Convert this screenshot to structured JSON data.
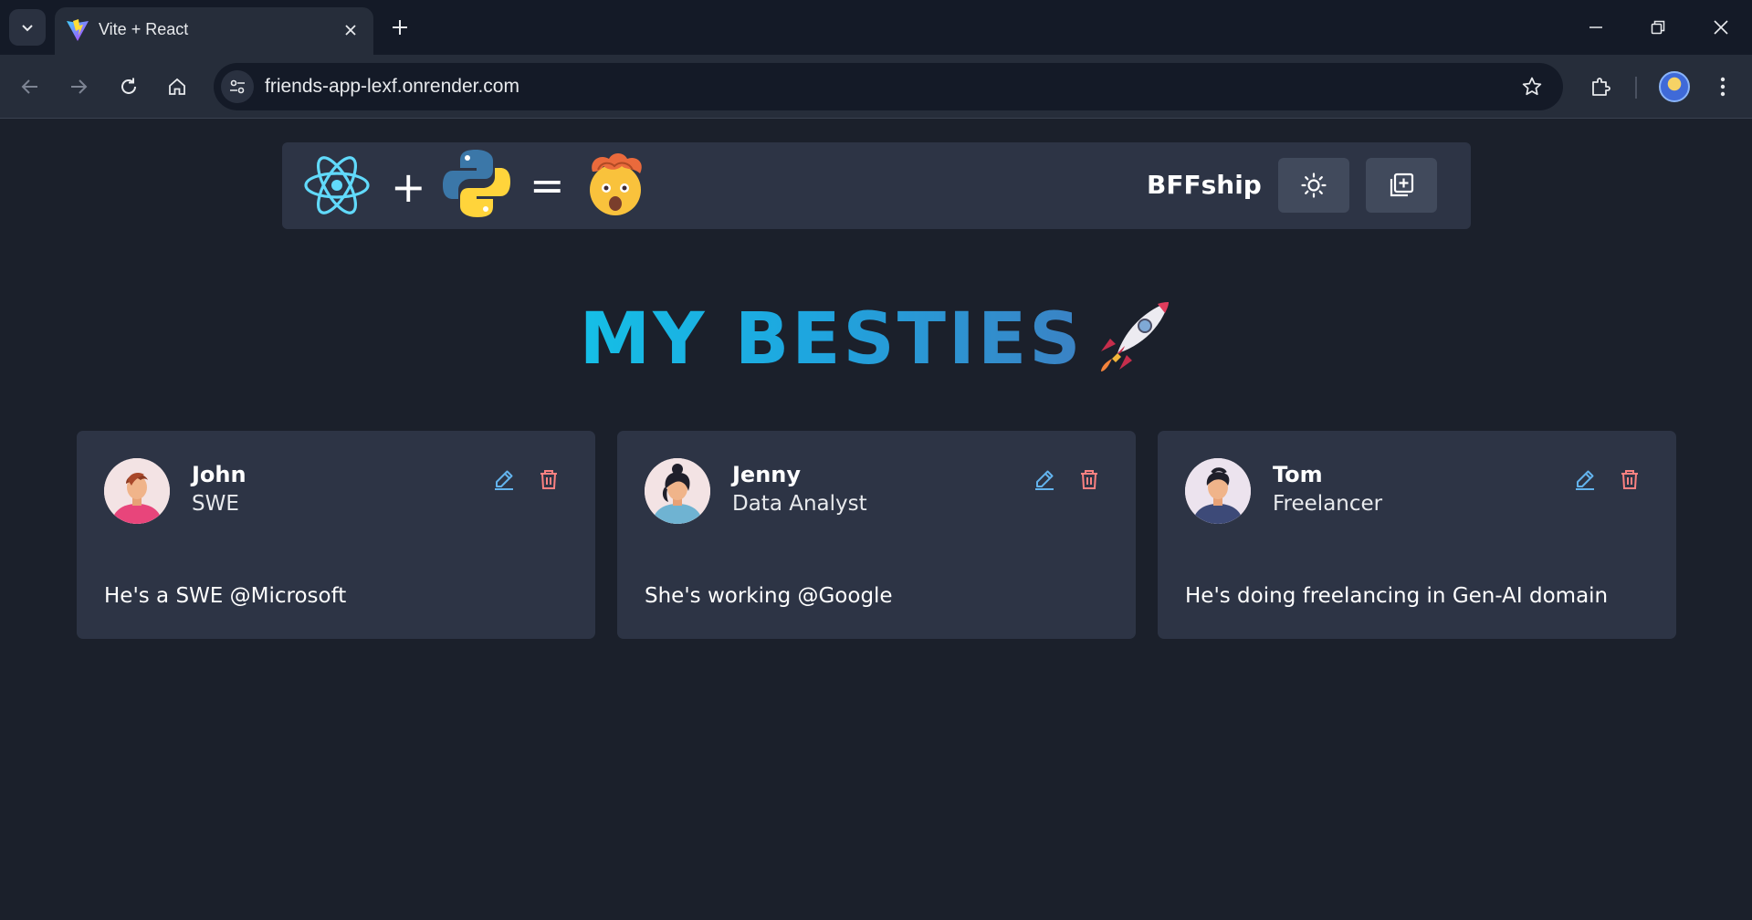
{
  "browser": {
    "tab_title": "Vite + React",
    "url": "friends-app-lexf.onrender.com",
    "icons": {
      "tab_search": "chevron-down-icon",
      "favicon": "vite-icon",
      "tab_close": "close-icon",
      "new_tab": "plus-icon",
      "minimize": "minimize-icon",
      "restore": "restore-icon",
      "close": "close-icon",
      "back": "arrow-left-icon",
      "forward": "arrow-right-icon",
      "reload": "reload-icon",
      "home": "home-icon",
      "site_info": "tune-icon",
      "bookmark": "star-icon",
      "extensions": "puzzle-icon",
      "menu": "kebab-menu-icon"
    }
  },
  "navbar": {
    "brand": "BFFship",
    "logo_plus": "+",
    "logo_equals": "=",
    "icons": {
      "react": "react-logo-icon",
      "python": "python-logo-icon",
      "mind_blown": "mind-blown-emoji-icon",
      "fire": "fire-icon",
      "theme_toggle": "sun-icon",
      "add_friend": "add-square-icon"
    }
  },
  "heading": {
    "text": "MY BESTIES",
    "icon": "rocket-icon",
    "gradient": [
      "#15bfe6",
      "#3b82c4"
    ]
  },
  "friends": [
    {
      "name": "John",
      "role": "SWE",
      "description": "He's a SWE @Microsoft"
    },
    {
      "name": "Jenny",
      "role": "Data Analyst",
      "description": "She's working @Google"
    },
    {
      "name": "Tom",
      "role": "Freelancer",
      "description": "He's doing freelancing in Gen-AI domain"
    }
  ],
  "colors": {
    "page_bg": "#1b202b",
    "card_bg": "#2d3445",
    "edit_icon": "#63b3ed",
    "delete_icon": "#fc8181"
  }
}
